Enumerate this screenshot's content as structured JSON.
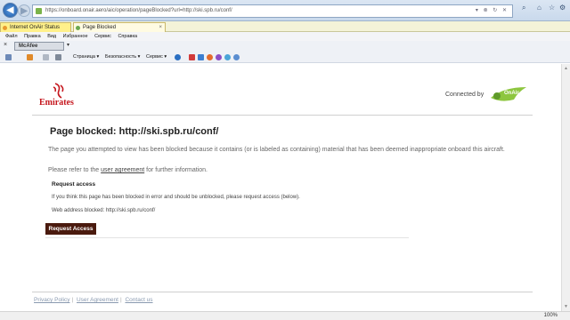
{
  "browser": {
    "address": "https://onboard.onair.aero/aic/operation/pageBlocked?url=http://ski.spb.ru/conf/",
    "tabs": [
      {
        "label": "Internet OnAir Status"
      },
      {
        "label": "Page Blocked"
      }
    ],
    "menu": [
      "Файл",
      "Правка",
      "Вид",
      "Избранное",
      "Сервис",
      "Справка"
    ],
    "mcafee_label": "McAfee",
    "command_bar": [
      "Страница ▾",
      "Безопасность ▾",
      "Сервис ▾"
    ],
    "zoom": "100%"
  },
  "page": {
    "brand": "Emirates",
    "connected_by": "Connected by",
    "onair": "OnAir",
    "title": "Page blocked: http://ski.spb.ru/conf/",
    "message": "The page you attempted to view has been blocked because it contains (or is labeled as containing) material that has been deemed inappropriate onboard this aircraft.",
    "refer_prefix": "Please refer to the ",
    "refer_link": "user agreement",
    "refer_suffix": " for further information.",
    "request_heading": "Request access",
    "request_text": "If you think this page has been blocked in error and should be unblocked, please request access (below).",
    "blocked_address": "Web address blocked: http://ski.spb.ru/conf/",
    "request_button": "Request Access",
    "footer": [
      "Privacy Policy",
      "User Agreement",
      "Contact us"
    ],
    "footer_sep": "|"
  }
}
